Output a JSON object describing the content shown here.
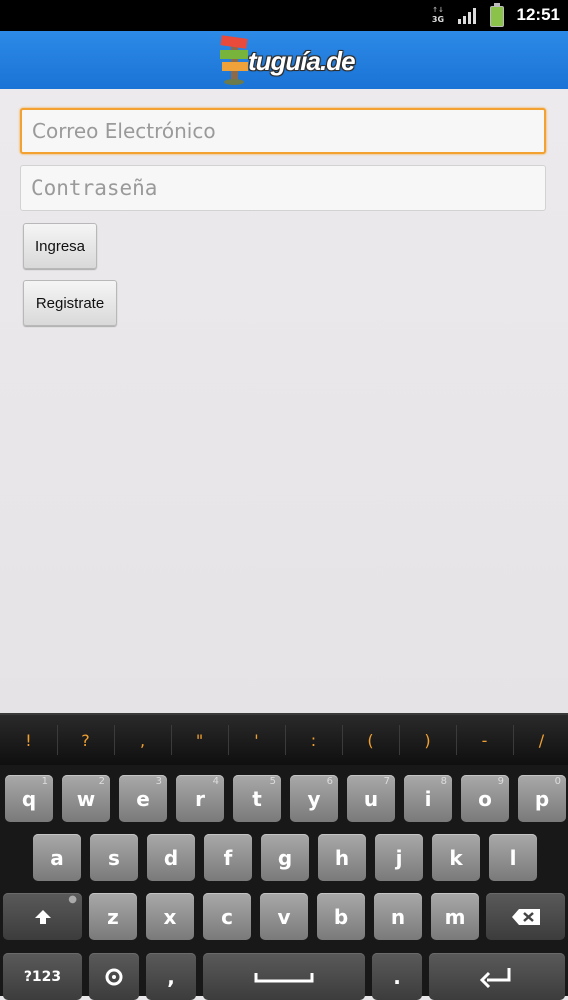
{
  "status_bar": {
    "network": "3G",
    "time": "12:51"
  },
  "app": {
    "logo_text": "tuguía.de"
  },
  "form": {
    "email_placeholder": "Correo Electrónico",
    "password_placeholder": "Contraseña",
    "login_label": "Ingresa",
    "register_label": "Registrate"
  },
  "keyboard": {
    "suggestions": [
      "!",
      "?",
      ",",
      "\"",
      "'",
      ":",
      "(",
      ")",
      "-",
      "/"
    ],
    "row1": [
      {
        "label": "q",
        "hint": "1"
      },
      {
        "label": "w",
        "hint": "2"
      },
      {
        "label": "e",
        "hint": "3"
      },
      {
        "label": "r",
        "hint": "4"
      },
      {
        "label": "t",
        "hint": "5"
      },
      {
        "label": "y",
        "hint": "6"
      },
      {
        "label": "u",
        "hint": "7"
      },
      {
        "label": "i",
        "hint": "8"
      },
      {
        "label": "o",
        "hint": "9"
      },
      {
        "label": "p",
        "hint": "0"
      }
    ],
    "row2": [
      "a",
      "s",
      "d",
      "f",
      "g",
      "h",
      "j",
      "k",
      "l"
    ],
    "row3": [
      "z",
      "x",
      "c",
      "v",
      "b",
      "n",
      "m"
    ],
    "symbols_label": "?123",
    "comma_label": ",",
    "period_label": "."
  }
}
